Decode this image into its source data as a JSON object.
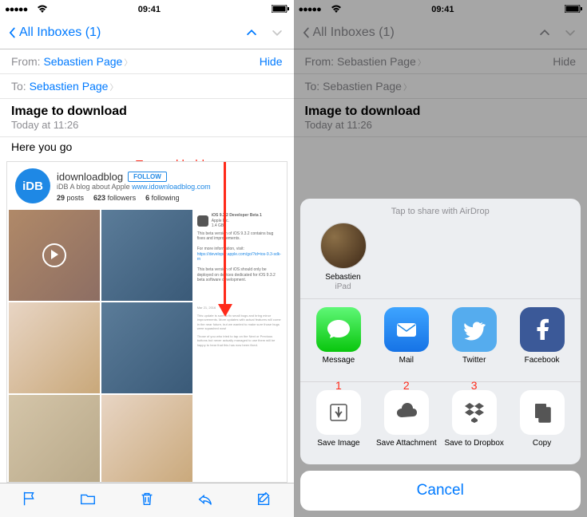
{
  "status": {
    "carrier": "●●●●●",
    "wifi": "wifi",
    "time": "09:41",
    "battery": "battery"
  },
  "nav": {
    "back_label": "All Inboxes (1)"
  },
  "mail": {
    "from_label": "From:",
    "to_label": "To:",
    "sender": "Sebastien Page",
    "recipient": "Sebastien Page",
    "hide": "Hide",
    "subject": "Image to download",
    "date": "Today at 11:26",
    "body": "Here you go"
  },
  "annotation": {
    "tap_hold": "Tap and hold",
    "n1": "1",
    "n2": "2",
    "n3": "3"
  },
  "embedded": {
    "handle": "idownloadblog",
    "follow": "FOLLOW",
    "logo": "iDB",
    "desc_prefix": "iDB A blog about Apple",
    "desc_link": "www.idownloadblog.com",
    "posts_n": "29",
    "posts_l": "posts",
    "foll_n": "623",
    "foll_l": "followers",
    "fol_n": "6",
    "fol_l": "following",
    "art_title": "iOS 9.3.2 Developer Beta 1",
    "art_sub": "Apple Inc.",
    "art_size": "1.4 GB",
    "art_p1": "This beta version of iOS 9.3.2 contains bug fixes and improvements.",
    "art_p2": "For more information, visit:",
    "art_link": "https://developer.apple.com/go/?id=ios-9.3-sdk-rn",
    "art_p3": "This beta version of iOS should only be deployed on devices dedicated for iOS 9.3.2 beta software development."
  },
  "share": {
    "airdrop_title": "Tap to share with AirDrop",
    "contact_name": "Sebastien",
    "contact_device": "iPad",
    "apps": [
      {
        "label": "Message"
      },
      {
        "label": "Mail"
      },
      {
        "label": "Twitter"
      },
      {
        "label": "Facebook"
      }
    ],
    "actions": [
      {
        "label": "Save Image"
      },
      {
        "label": "Save Attachment"
      },
      {
        "label": "Save to Dropbox"
      },
      {
        "label": "Copy"
      }
    ],
    "cancel": "Cancel"
  }
}
